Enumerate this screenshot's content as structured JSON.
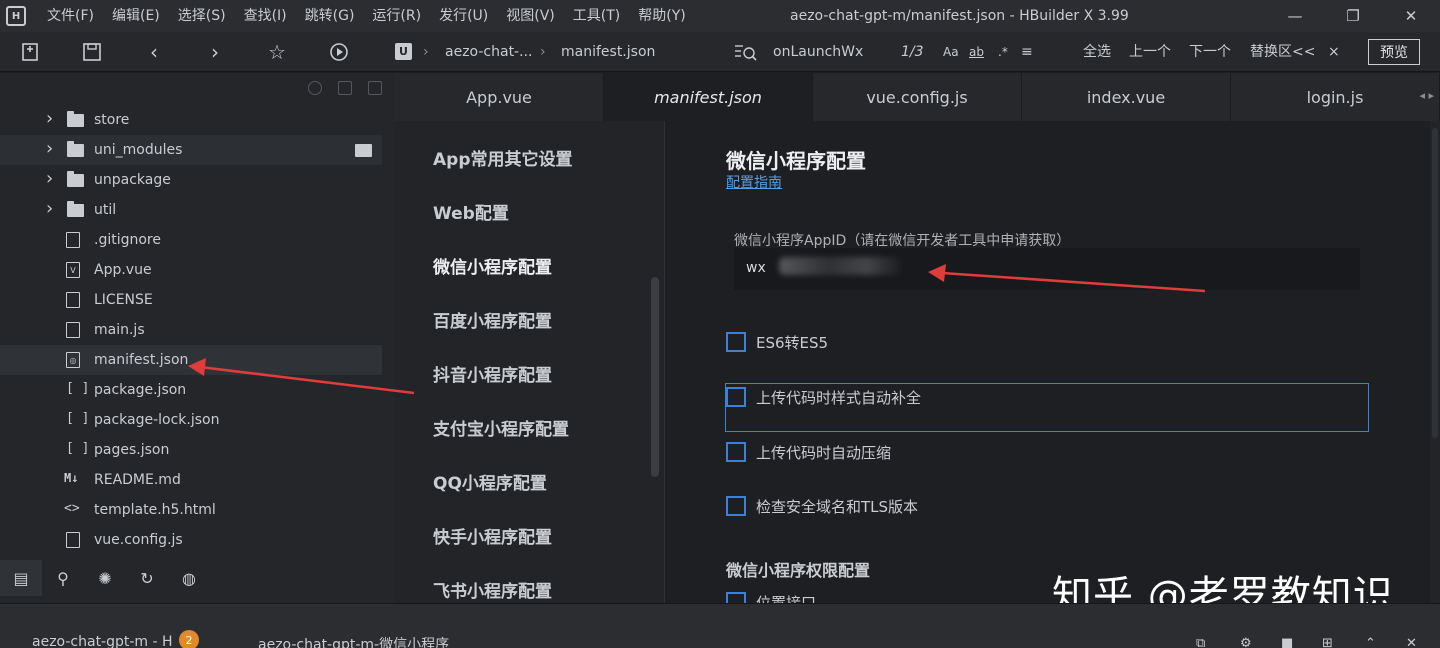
{
  "titlebar": {
    "menu": [
      "文件(F)",
      "编辑(E)",
      "选择(S)",
      "查找(I)",
      "跳转(G)",
      "运行(R)",
      "发行(U)",
      "视图(V)",
      "工具(T)",
      "帮助(Y)"
    ],
    "title": "aezo-chat-gpt-m/manifest.json - HBuilder X 3.99",
    "controls": [
      "minimize",
      "restore",
      "close"
    ]
  },
  "toolbar": {
    "breadcrumb_project": "aezo-chat-...",
    "breadcrumb_file": "manifest.json",
    "search_term": "onLaunchWx",
    "search_count": "1/3",
    "opt_case": "Aa",
    "opt_word": "ab",
    "opt_regex": ".*",
    "select_all": "全选",
    "prev": "上一个",
    "next": "下一个",
    "replace": "替换区<<",
    "close": "×",
    "preview": "预览"
  },
  "sidebar": {
    "items": [
      {
        "label": "store",
        "type": "folder"
      },
      {
        "label": "uni_modules",
        "type": "folder"
      },
      {
        "label": "unpackage",
        "type": "folder"
      },
      {
        "label": "util",
        "type": "folder"
      },
      {
        "label": ".gitignore",
        "type": "file"
      },
      {
        "label": "App.vue",
        "type": "vue"
      },
      {
        "label": "LICENSE",
        "type": "file"
      },
      {
        "label": "main.js",
        "type": "js"
      },
      {
        "label": "manifest.json",
        "type": "manifest"
      },
      {
        "label": "package.json",
        "type": "json"
      },
      {
        "label": "package-lock.json",
        "type": "json"
      },
      {
        "label": "pages.json",
        "type": "json"
      },
      {
        "label": "README.md",
        "type": "md"
      },
      {
        "label": "template.h5.html",
        "type": "html"
      },
      {
        "label": "vue.config.js",
        "type": "js"
      }
    ]
  },
  "tabs": [
    "App.vue",
    "manifest.json",
    "vue.config.js",
    "index.vue",
    "login.js"
  ],
  "manifest_nav": [
    "App常用其它设置",
    "Web配置",
    "微信小程序配置",
    "百度小程序配置",
    "抖音小程序配置",
    "支付宝小程序配置",
    "QQ小程序配置",
    "快手小程序配置",
    "飞书小程序配置"
  ],
  "content": {
    "title": "微信小程序配置",
    "guide_link": "配置指南",
    "appid_label": "微信小程序AppID（请在微信开发者工具中申请获取）",
    "appid_value": "wx",
    "checkboxes": [
      "ES6转ES5",
      "上传代码时样式自动补全",
      "上传代码时自动压缩",
      "检查安全域名和TLS版本"
    ],
    "section_permission": "微信小程序权限配置",
    "permission_first": "位置接口"
  },
  "statusbar": {
    "left_project": "aezo-chat-gpt-m - H",
    "badge": "2",
    "right_project": "aezo-chat-gpt-m-微信小程序"
  },
  "watermark": "知乎 @老罗教知识",
  "colors": {
    "accent": "#3f7fd6",
    "link": "#4ea0e8",
    "annotation_arrow": "#e03c3c",
    "badge": "#e08a2c"
  }
}
